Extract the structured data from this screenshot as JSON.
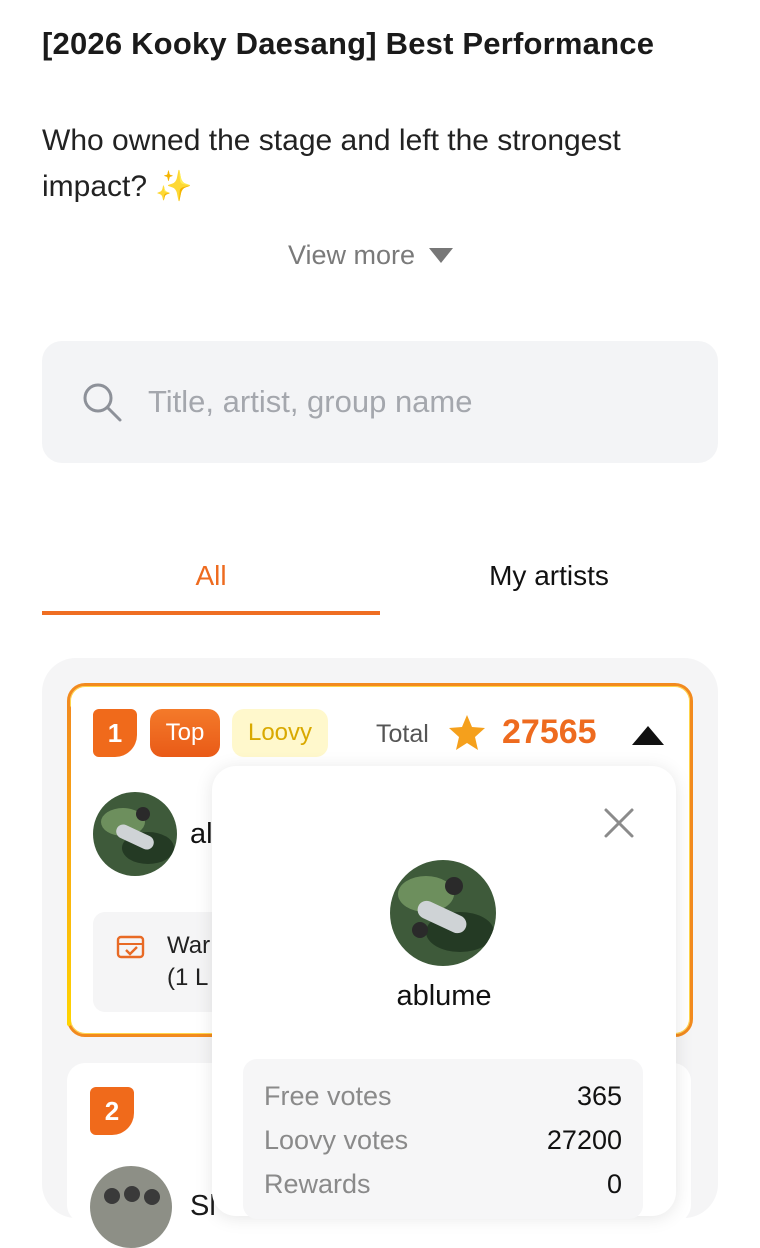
{
  "header": {
    "title": "[2026 Kooky Daesang] Best Performance",
    "description": "Who owned the stage and left the strongest impact? ✨",
    "view_more": "View more"
  },
  "search": {
    "placeholder": "Title, artist, group name"
  },
  "tabs": [
    {
      "label": "All",
      "active": true
    },
    {
      "label": "My artists",
      "active": false
    }
  ],
  "ranking": [
    {
      "rank": "1",
      "badges": [
        "Top",
        "Loovy"
      ],
      "total_label": "Total",
      "total": "27565",
      "name_truncated": "al",
      "info_text": "War\n(1 L",
      "expanded": true
    },
    {
      "rank": "2",
      "name_truncated": "Sl"
    }
  ],
  "popup": {
    "name": "ablume",
    "stats": [
      {
        "label": "Free votes",
        "value": "365"
      },
      {
        "label": "Loovy votes",
        "value": "27200"
      },
      {
        "label": "Rewards",
        "value": "0"
      }
    ]
  },
  "colors": {
    "accent": "#EE6B1F",
    "loovy_bg": "#FFF8CC",
    "loovy_text": "#D9A900"
  },
  "icons": [
    "search-icon",
    "triangle-down-icon",
    "star-icon",
    "triangle-up-icon",
    "calendar-check-icon",
    "close-icon"
  ]
}
